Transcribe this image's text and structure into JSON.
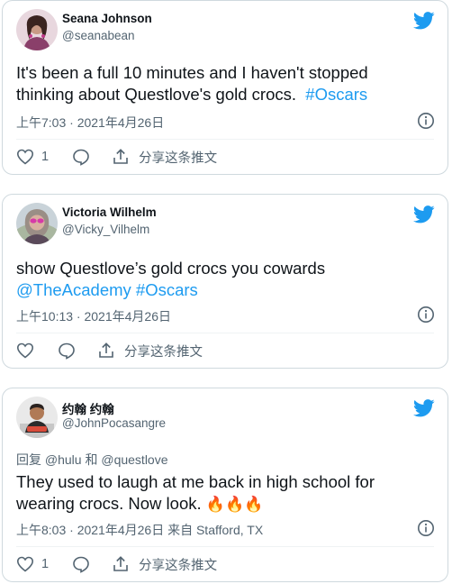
{
  "colors": {
    "accent": "#1d9bf0",
    "muted": "#536471",
    "border": "#cfd9de"
  },
  "tweets": [
    {
      "name": "Seana Johnson",
      "handle": "@seanabean",
      "text": "It's been a full 10 minutes and I haven't stopped thinking about Questlove's gold crocs.",
      "hashtag": "#Oscars",
      "timestamp": "上午7:03 · 2021年4月26日",
      "like_count": "1",
      "share_label": "分享这条推文"
    },
    {
      "name": "Victoria Wilhelm",
      "handle": "@Vicky_Vilhelm",
      "text": "show Questlove’s gold crocs you cowards",
      "mention": "@TheAcademy",
      "hashtag": "#Oscars",
      "timestamp": "上午10:13 · 2021年4月26日",
      "share_label": "分享这条推文"
    },
    {
      "name": "约翰 约翰",
      "handle": "@JohnPocasangre",
      "reply_prefix": "回复",
      "reply_user1": "@hulu",
      "reply_and": "和",
      "reply_user2": "@questlove",
      "text": "They used to laugh at me back in high school for wearing crocs. Now look.",
      "emoji": "🔥🔥🔥",
      "timestamp": "上午8:03 · 2021年4月26日 来自 Stafford, TX",
      "like_count": "1",
      "share_label": "分享这条推文"
    }
  ]
}
